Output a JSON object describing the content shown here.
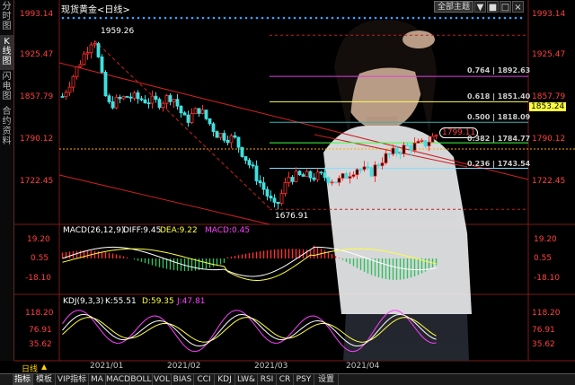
{
  "header": {
    "title": "现货黄金<日线>",
    "theme_button": "全部主题",
    "window_buttons": [
      "▼",
      "■",
      "□",
      "×"
    ]
  },
  "left_tabs": [
    "分时图",
    "K线图",
    "闪电图",
    "合约资料"
  ],
  "price_axis": {
    "left_labels": [
      "1993.14",
      "1925.47",
      "1857.79",
      "1790.12",
      "1722.45"
    ],
    "right_labels": [
      "1993.14",
      "1925.47",
      "1857.79",
      "1853.24",
      "1790.12",
      "1722.45"
    ],
    "highlight_value": "1853.24"
  },
  "annotations": {
    "high": "1959.26",
    "low": "1676.91",
    "current": "1799.11"
  },
  "fibonacci": [
    {
      "label": "0.764 | 1892.63",
      "ratio": 0.764,
      "value": 1892.63,
      "color": "#e040e0"
    },
    {
      "label": "0.618 | 1851.40",
      "ratio": 0.618,
      "value": 1851.4,
      "color": "#ffff60"
    },
    {
      "label": "0.500 | 1818.09",
      "ratio": 0.5,
      "value": 1818.09,
      "color": "#40b0b0"
    },
    {
      "label": "0.382 | 1784.77",
      "ratio": 0.382,
      "value": 1784.77,
      "color": "#40ff40"
    },
    {
      "label": "0.236 | 1743.54",
      "ratio": 0.236,
      "value": 1743.54,
      "color": "#80e0ff"
    }
  ],
  "macd": {
    "title": "MACD(26,12,9)",
    "diff": "DIFF:9.45",
    "dea": "DEA:9.22",
    "macd": "MACD:0.45",
    "left_labels": [
      "19.20",
      "0.55",
      "-18.10"
    ],
    "right_labels": [
      "19.20",
      "0.55",
      "-18.10"
    ]
  },
  "kdj": {
    "title": "KDJ(9,3,3)",
    "k": "K:55.51",
    "d": "D:59.35",
    "j": "J:47.81",
    "left_labels": [
      "118.20",
      "76.91",
      "35.62"
    ],
    "right_labels": [
      "118.20",
      "76.91",
      "35.62"
    ]
  },
  "dates": [
    "2021/01",
    "2021/02",
    "2021/03",
    "2021/04"
  ],
  "period": "日线",
  "period_arrow": "▲",
  "bottom_tabs": [
    "指标",
    "模板",
    "VIP指标",
    "MA",
    "MACD",
    "BOLL",
    "VOL",
    "BIAS",
    "CCI",
    "KDJ",
    "LW&",
    "RSI",
    "CR",
    "PSY",
    "设置"
  ],
  "colors": {
    "bull": "#ff3030",
    "bear": "#40e0e0",
    "axis": "#ff4040",
    "diff": "#ffffff",
    "dea": "#ffff40",
    "macd": "#ff40ff",
    "k": "#ffffff",
    "d": "#ffff40",
    "j": "#ff40ff"
  }
}
